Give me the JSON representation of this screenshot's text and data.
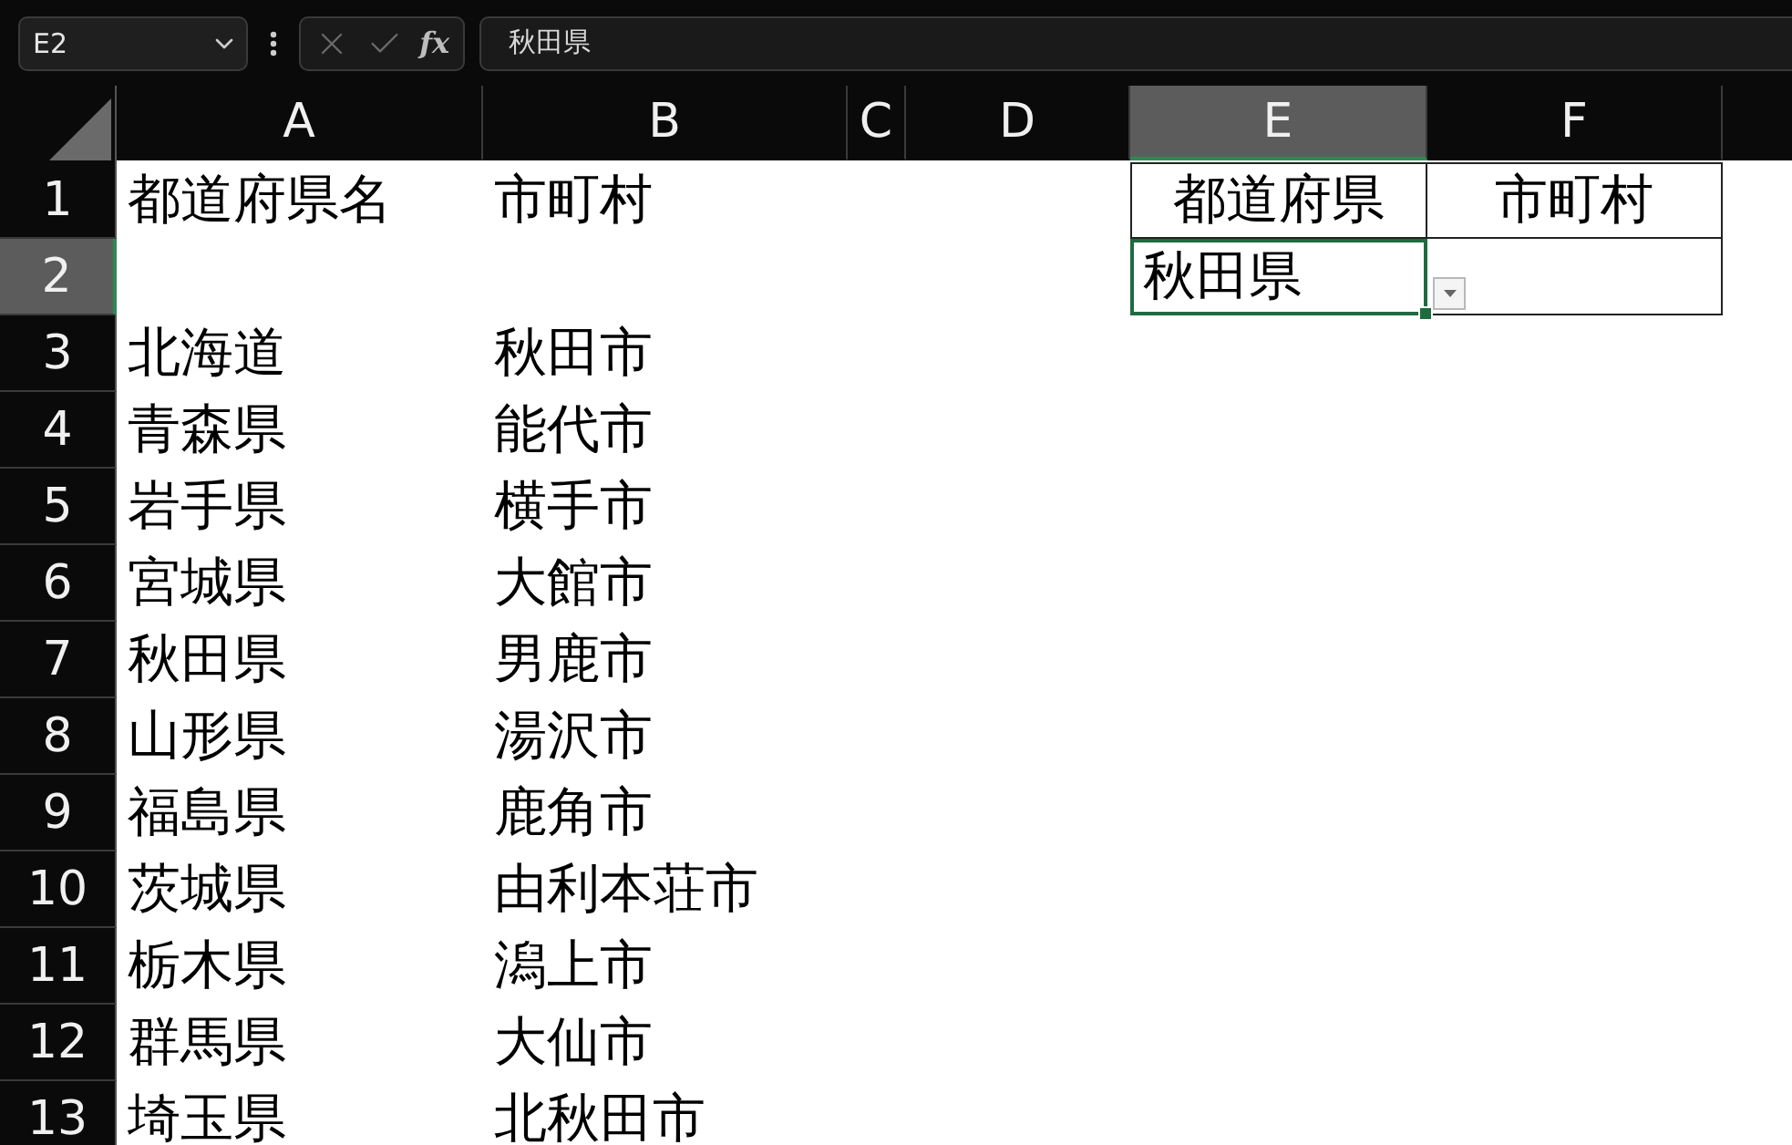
{
  "name_box": {
    "value": "E2"
  },
  "formula_bar": {
    "function_label": "fx",
    "value": "秋田県"
  },
  "columns": [
    {
      "label": "A",
      "selected": false
    },
    {
      "label": "B",
      "selected": false
    },
    {
      "label": "C",
      "selected": false
    },
    {
      "label": "D",
      "selected": false
    },
    {
      "label": "E",
      "selected": true
    },
    {
      "label": "F",
      "selected": false
    }
  ],
  "rows": [
    {
      "label": "1",
      "selected": false,
      "boxed": true,
      "col_a": {
        "text": "都道府県名"
      },
      "col_b": {
        "text": "市町村"
      },
      "col_e": {
        "text": "都道府県",
        "centered": true
      },
      "col_f": {
        "text": "市町村",
        "centered": true
      }
    },
    {
      "label": "2",
      "selected": true,
      "boxed": true,
      "col_e": {
        "text": "秋田県"
      }
    },
    {
      "label": "3",
      "selected": false,
      "col_a": {
        "text": "北海道"
      },
      "col_b": {
        "text": "秋田市"
      }
    },
    {
      "label": "4",
      "selected": false,
      "col_a": {
        "text": "青森県"
      },
      "col_b": {
        "text": "能代市"
      }
    },
    {
      "label": "5",
      "selected": false,
      "col_a": {
        "text": "岩手県"
      },
      "col_b": {
        "text": "横手市"
      }
    },
    {
      "label": "6",
      "selected": false,
      "col_a": {
        "text": "宮城県"
      },
      "col_b": {
        "text": "大館市"
      }
    },
    {
      "label": "7",
      "selected": false,
      "col_a": {
        "text": "秋田県"
      },
      "col_b": {
        "text": "男鹿市"
      }
    },
    {
      "label": "8",
      "selected": false,
      "col_a": {
        "text": "山形県"
      },
      "col_b": {
        "text": "湯沢市"
      }
    },
    {
      "label": "9",
      "selected": false,
      "col_a": {
        "text": "福島県"
      },
      "col_b": {
        "text": "鹿角市"
      }
    },
    {
      "label": "10",
      "selected": false,
      "col_a": {
        "text": "茨城県"
      },
      "col_b": {
        "text": "由利本荘市"
      }
    },
    {
      "label": "11",
      "selected": false,
      "col_a": {
        "text": "栃木県"
      },
      "col_b": {
        "text": "潟上市"
      }
    },
    {
      "label": "12",
      "selected": false,
      "col_a": {
        "text": "群馬県"
      },
      "col_b": {
        "text": "大仙市"
      }
    },
    {
      "label": "13",
      "selected": false,
      "col_a": {
        "text": "埼玉県"
      },
      "col_b": {
        "text": "北秋田市"
      }
    }
  ]
}
